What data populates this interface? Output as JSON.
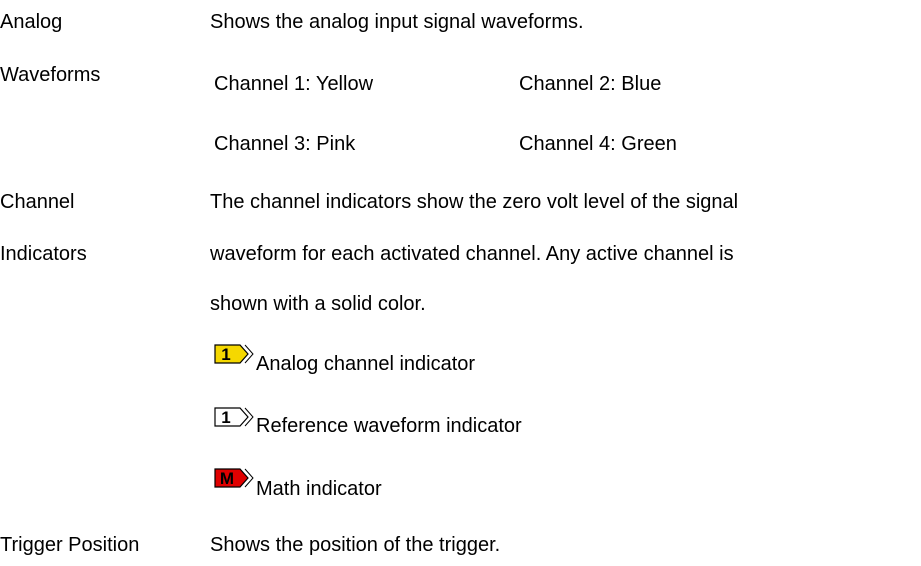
{
  "sections": {
    "analog": {
      "term_line1": "Analog",
      "term_line2": "Waveforms",
      "description": "Shows the analog input signal waveforms.",
      "channels": [
        "Channel 1: Yellow",
        "Channel 2: Blue",
        "Channel 3: Pink",
        "Channel 4: Green"
      ]
    },
    "indicators": {
      "term_line1": "Channel",
      "term_line2": "Indicators",
      "desc_lines": [
        "The channel indicators show the zero volt level of the signal",
        "waveform for each activated channel. Any active channel is",
        "shown with a solid color."
      ],
      "items": [
        {
          "label": "Analog channel indicator",
          "icon": "analog-channel-indicator-icon",
          "glyph": "1",
          "fill": "#f5d800",
          "text_color": "#000000"
        },
        {
          "label": "Reference waveform indicator",
          "icon": "reference-waveform-indicator-icon",
          "glyph": "1",
          "fill": "#ffffff",
          "text_color": "#000000"
        },
        {
          "label": "Math indicator",
          "icon": "math-indicator-icon",
          "glyph": "M",
          "fill": "#e00000",
          "text_color": "#000000"
        }
      ]
    },
    "trigger": {
      "term": "Trigger Position",
      "description": "Shows the position of the trigger."
    }
  }
}
